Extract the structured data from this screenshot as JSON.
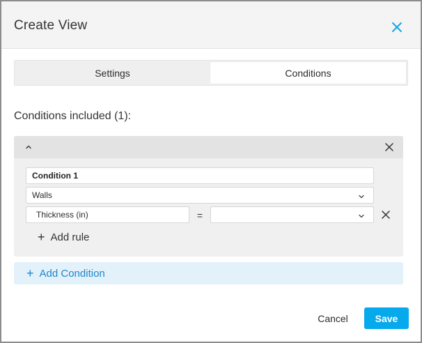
{
  "dialog": {
    "title": "Create View",
    "close_icon": "close-icon"
  },
  "tabs": [
    {
      "label": "Settings",
      "active": false
    },
    {
      "label": "Conditions",
      "active": true
    }
  ],
  "conditions_label": "Conditions included (1):",
  "condition": {
    "name": "Condition 1",
    "category": "Walls",
    "rule": {
      "parameter": "Thickness (in)",
      "operator": "=",
      "value": ""
    },
    "add_rule_label": "Add rule"
  },
  "add_condition_label": "Add Condition",
  "footer": {
    "cancel_label": "Cancel",
    "save_label": "Save"
  },
  "colors": {
    "accent": "#06a9ec",
    "link": "#1e86c8",
    "header_bg": "#f4f4f4"
  }
}
